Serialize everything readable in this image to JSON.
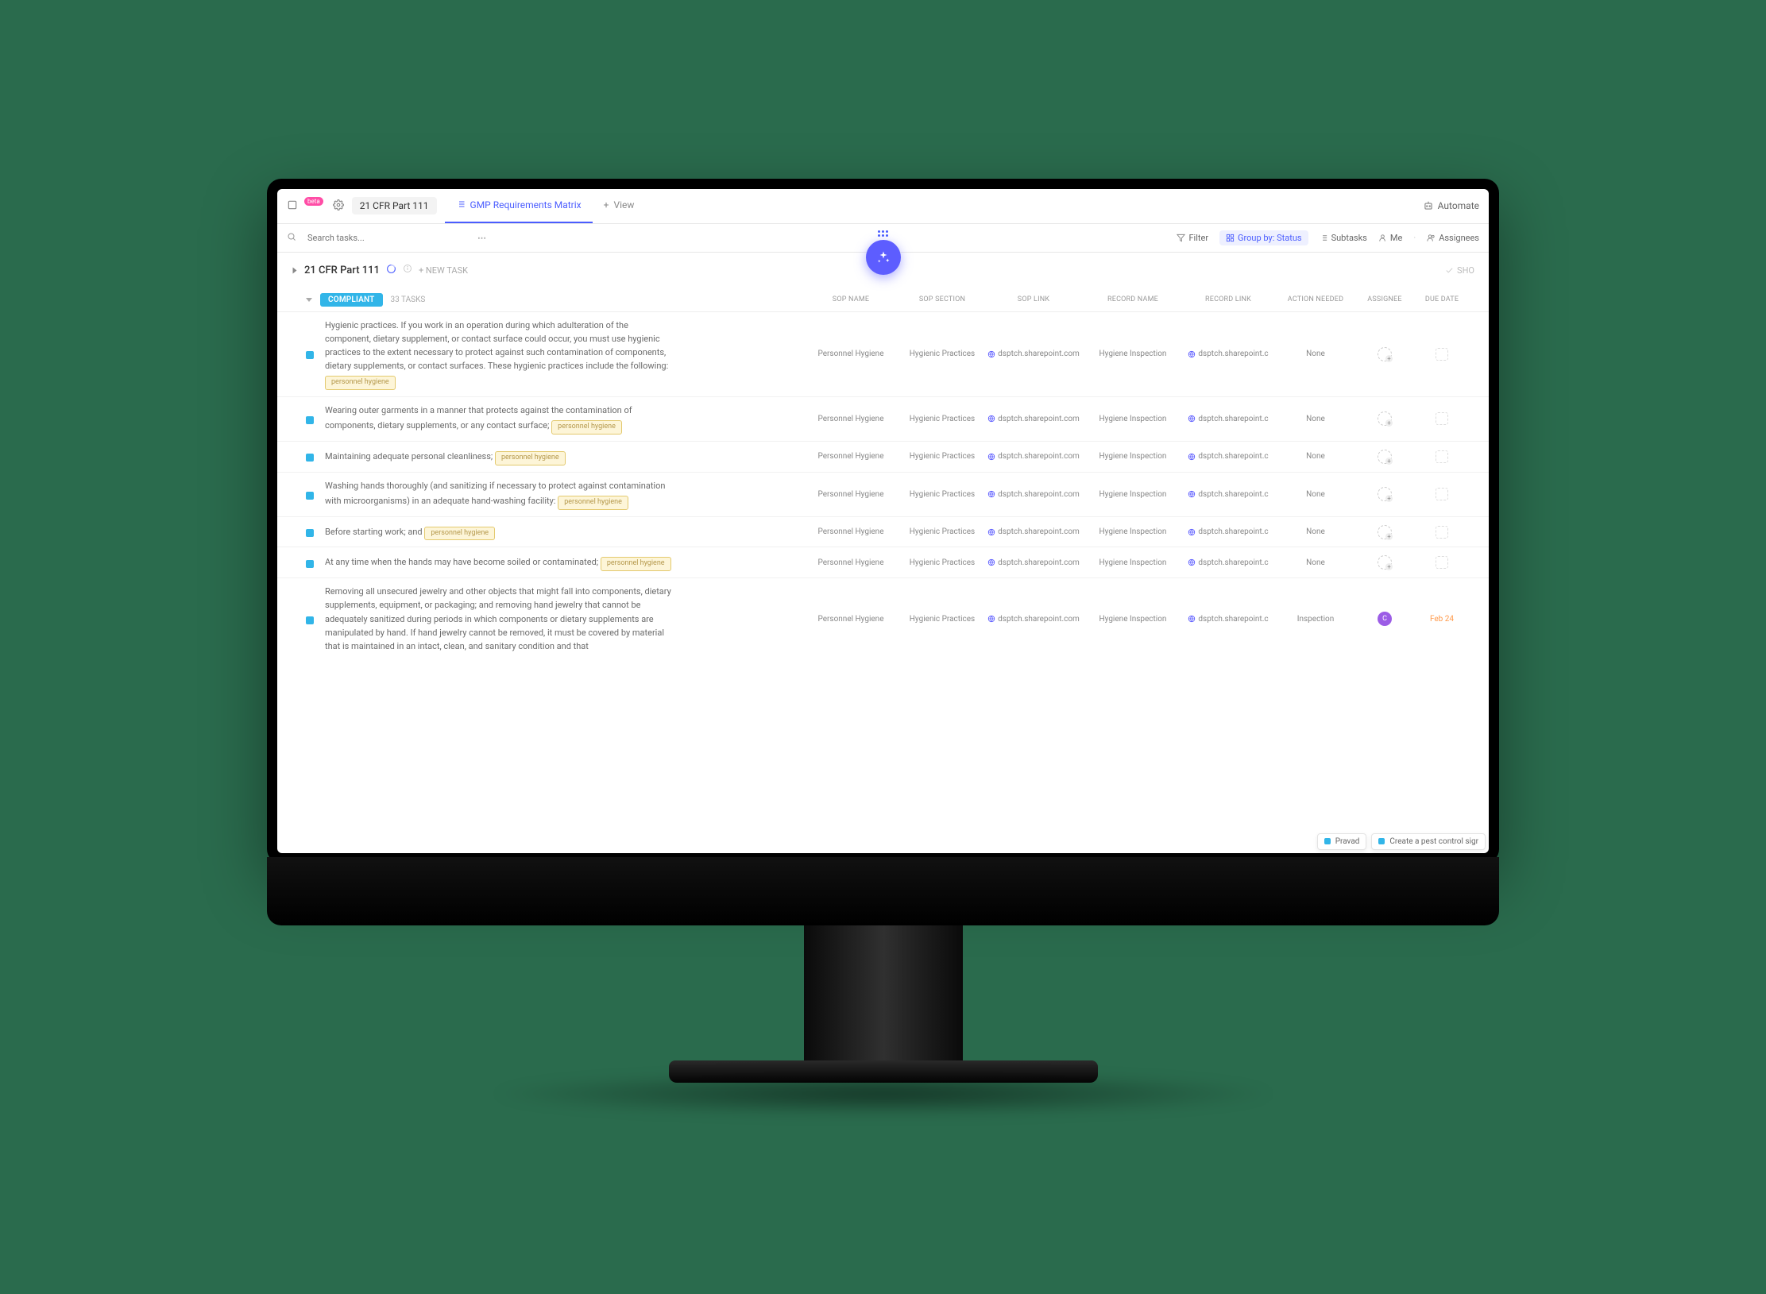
{
  "topbar": {
    "badge": "beta",
    "title": "21 CFR Part 111",
    "tabs": [
      {
        "label": "GMP Requirements Matrix",
        "active": true,
        "icon": "list-icon"
      },
      {
        "label": "View",
        "active": false,
        "icon": "plus-icon"
      }
    ],
    "automate": "Automate"
  },
  "toolbar": {
    "search_placeholder": "Search tasks...",
    "filter": "Filter",
    "group_by": "Group by: Status",
    "subtasks": "Subtasks",
    "me": "Me",
    "assignees": "Assignees"
  },
  "list_header": {
    "title": "21 CFR Part 111",
    "new_task": "+ NEW TASK",
    "show": "SHO"
  },
  "group": {
    "status": "COMPLIANT",
    "count": "33 TASKS",
    "columns": [
      "SOP NAME",
      "SOP SECTION",
      "SOP LINK",
      "RECORD NAME",
      "RECORD LINK",
      "ACTION NEEDED",
      "ASSIGNEE",
      "DUE DATE"
    ]
  },
  "common_cells": {
    "sop_name": "Personnel Hygiene",
    "sop_section": "Hygienic Practices",
    "sop_link": "dsptch.sharepoint.com",
    "record_name": "Hygiene Inspection",
    "record_link": "dsptch.sharepoint.c",
    "action_none": "None",
    "action_inspection": "Inspection",
    "due_feb24": "Feb 24",
    "assignee_initial": "C"
  },
  "rows": [
    {
      "desc": "Hygienic practices. If you work in an operation during which adulteration of the component, dietary supplement, or contact surface could occur, you must use hygienic practices to the extent necessary to protect against such contamination of components, dietary supplements, or contact surfaces. These hygienic practices include the following:",
      "tag": "personnel hygiene",
      "action": "None",
      "assignee": "empty",
      "due": ""
    },
    {
      "desc": "Wearing outer garments in a manner that protects against the contamination of components, dietary supplements, or any contact surface;",
      "tag": "personnel hygiene",
      "action": "None",
      "assignee": "empty",
      "due": ""
    },
    {
      "desc": "Maintaining adequate personal cleanliness;",
      "tag": "personnel hygiene",
      "action": "None",
      "assignee": "empty",
      "due": ""
    },
    {
      "desc": "Washing hands thoroughly (and sanitizing if necessary to protect against contamination with microorganisms) in an adequate hand-washing facility:",
      "tag": "personnel hygiene",
      "action": "None",
      "assignee": "empty",
      "due": ""
    },
    {
      "desc": "Before starting work; and",
      "tag": "personnel hygiene",
      "action": "None",
      "assignee": "empty",
      "due": ""
    },
    {
      "desc": "At any time when the hands may have become soiled or contaminated;",
      "tag": "personnel hygiene",
      "action": "None",
      "assignee": "empty",
      "due": ""
    },
    {
      "desc": "Removing all unsecured jewelry and other objects that might fall into components, dietary supplements, equipment, or packaging; and removing hand jewelry that cannot be adequately sanitized during periods in which components or dietary supplements are manipulated by hand. If hand jewelry cannot be removed, it must be covered by material that is maintained in an intact, clean, and sanitary condition and that",
      "tag": "",
      "action": "Inspection",
      "assignee": "solid",
      "due": "Feb 24"
    }
  ],
  "floating": {
    "a": "Pravad",
    "b": "Create a pest control sigr"
  }
}
